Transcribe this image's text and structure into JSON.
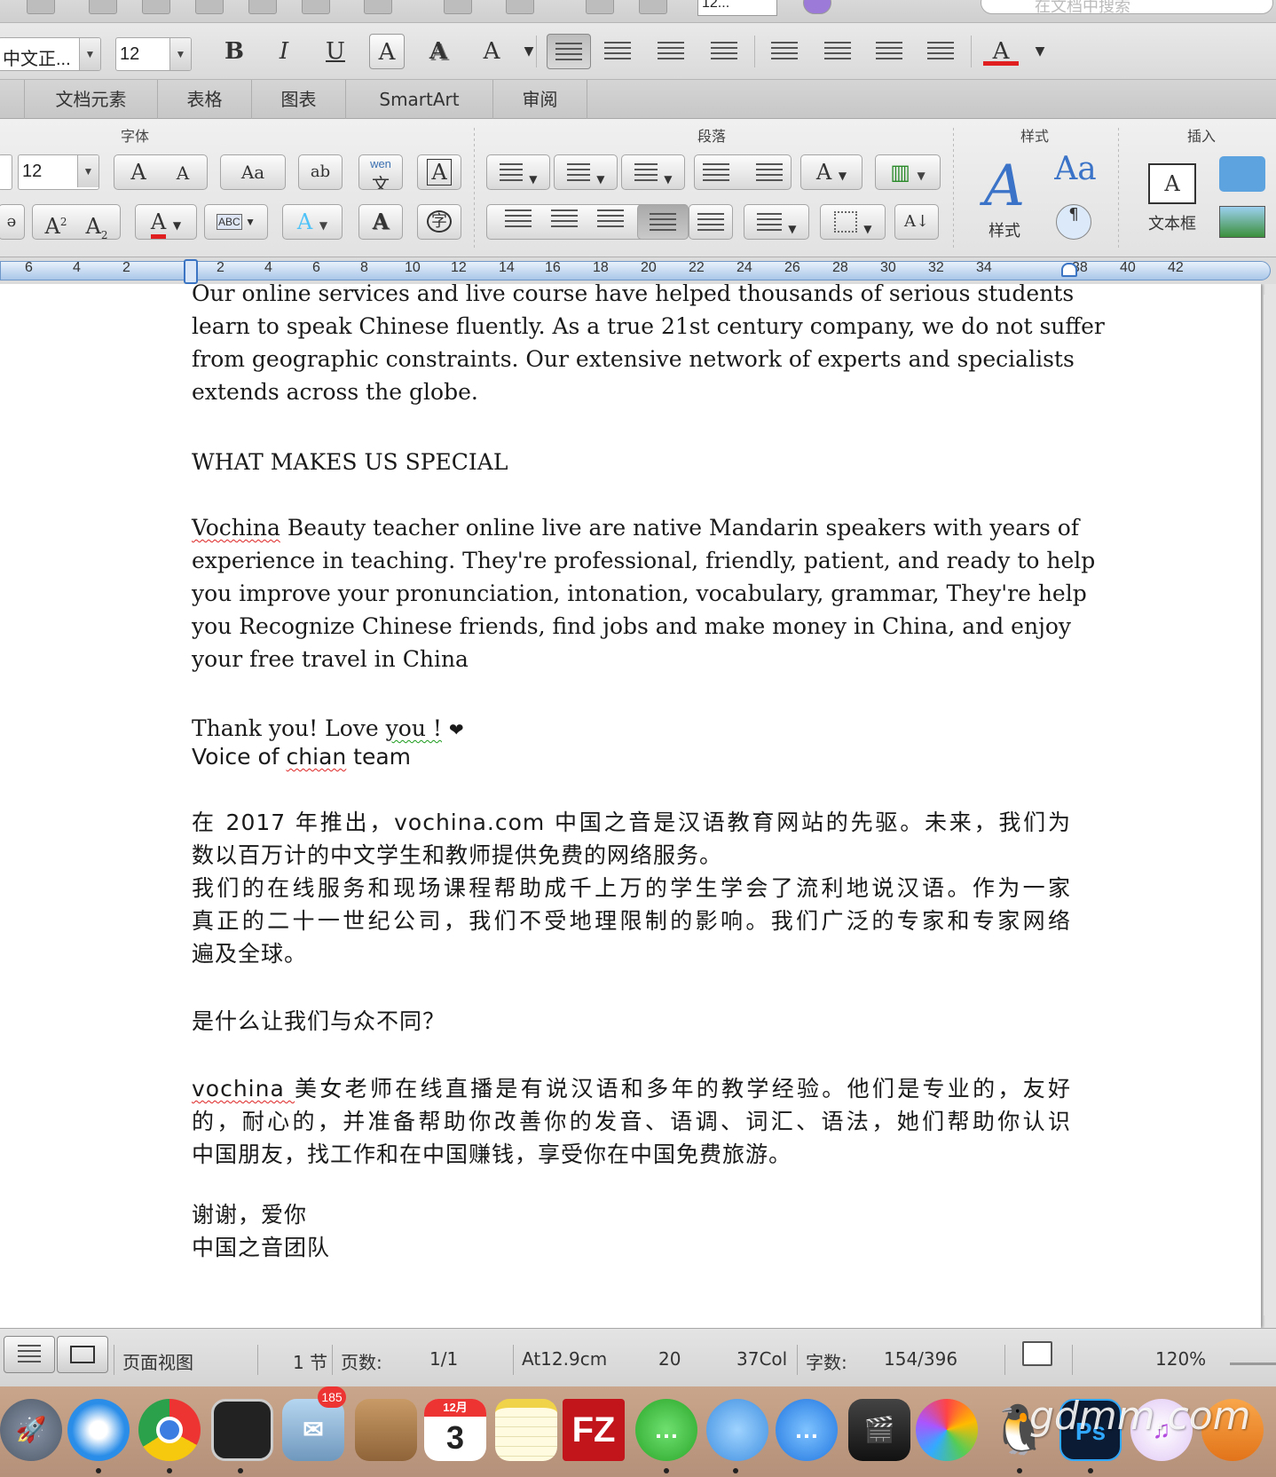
{
  "quickbar": {
    "zoom_value": "12...",
    "search_placeholder": "在文档中搜索"
  },
  "format_toolbar": {
    "font_name": "中文正...",
    "font_size": "12",
    "bold": "B",
    "italic": "I",
    "underline": "U",
    "outline": "A",
    "shadow": "A",
    "char_spacing": "A",
    "font_color": "A"
  },
  "tabs": [
    "文档元素",
    "表格",
    "图表",
    "SmartArt",
    "审阅"
  ],
  "ribbon": {
    "groups": {
      "font": "字体",
      "paragraph": "段落",
      "styles": "样式",
      "insert": "插入"
    },
    "font_size": "12",
    "phonetic_top": "wen",
    "phonetic_char": "文",
    "styles_label": "样式",
    "textbox_label": "文本框",
    "grow_font": "A",
    "shrink_font": "A",
    "change_case": "Aa",
    "superscript": "A",
    "subscript": "A",
    "text_highlight": "ABC",
    "enclose_char": "字"
  },
  "ruler": {
    "ticks": [
      "6",
      "4",
      "2",
      "2",
      "4",
      "6",
      "8",
      "10",
      "12",
      "14",
      "16",
      "18",
      "20",
      "22",
      "24",
      "26",
      "28",
      "30",
      "32",
      "34",
      "38",
      "40",
      "42"
    ]
  },
  "document": {
    "para1": [
      "Our online services and live course have helped thousands of serious students",
      "learn to speak Chinese fluently. As a true 21st century company, we do not suffer",
      "from geographic constraints. Our extensive network of experts and specialists",
      "extends across the globe."
    ],
    "heading": "WHAT MAKES US SPECIAL",
    "para2_first_word": "Vochina",
    "para2": [
      " Beauty teacher online live are native Mandarin speakers with years of",
      "experience in teaching. They're professional, friendly, patient, and ready to help",
      "you improve your pronunciation, intonation, vocabulary, grammar, They're help",
      "you Recognize Chinese friends, find jobs and make money in China, and enjoy",
      "your free travel in China"
    ],
    "thanks_prefix": "Thank you! Love ",
    "thanks_you": "you !",
    "thanks_heart": "❤",
    "team_prefix": "Voice of ",
    "team_chian": "chian",
    "team_suffix": " team",
    "cn_para1": [
      "在 2017 年推出，vochina.com 中国之音是汉语教育网站的先驱。未来，我们为",
      "数以百万计的中文学生和教师提供免费的网络服务。"
    ],
    "cn_para2": [
      "我们的在线服务和现场课程帮助成千上万的学生学会了流利地说汉语。作为一家",
      "真正的二十一世纪公司，我们不受地理限制的影响。我们广泛的专家和专家网络",
      "遍及全球。"
    ],
    "cn_heading": "是什么让我们与众不同？",
    "cn_para3_first": "vochina ",
    "cn_para3": [
      "美女老师在线直播是有说汉语和多年的教学经验。他们是专业的，友好",
      "的，耐心的，并准备帮助你改善你的发音、语调、词汇、语法，她们帮助你认识",
      "中国朋友，找工作和在中国赚钱，享受你在中国免费旅游。"
    ],
    "cn_thanks": "谢谢，爱你",
    "cn_team": "中国之音团队"
  },
  "status": {
    "view": "页面视图",
    "section": "1 节",
    "pages_label": "页数:",
    "pages_value": "1/1",
    "position": "At12.9cm",
    "line": "20",
    "col": "37Col",
    "words_label": "字数:",
    "words_value": "154/396",
    "zoom": "120%"
  },
  "dock": {
    "mail_badge": "185",
    "calendar_month": "12月",
    "calendar_day": "3",
    "filezilla": "FZ",
    "ps": "Ps",
    "watermark": "gdmm.com"
  },
  "colors": {
    "ruler_blue": "#a9c6e8",
    "font_color_red": "#e02020",
    "spell_red": "#d22222",
    "grammar_green": "#1a9a1a"
  }
}
